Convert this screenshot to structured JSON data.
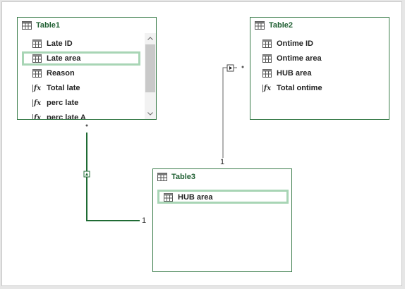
{
  "table1": {
    "title": "Table1",
    "fields": [
      {
        "label": "Late ID",
        "type": "column"
      },
      {
        "label": "Late area",
        "type": "column"
      },
      {
        "label": "Reason",
        "type": "column"
      },
      {
        "label": "Total late",
        "type": "measure"
      },
      {
        "label": "perc late",
        "type": "measure"
      },
      {
        "label": "perc late A",
        "type": "measure"
      }
    ]
  },
  "table2": {
    "title": "Table2",
    "fields": [
      {
        "label": "Ontime ID",
        "type": "column"
      },
      {
        "label": "Ontime area",
        "type": "column"
      },
      {
        "label": "HUB area",
        "type": "column"
      },
      {
        "label": "Total ontime",
        "type": "measure"
      }
    ]
  },
  "table3": {
    "title": "Table3",
    "fields": [
      {
        "label": "HUB area",
        "type": "column"
      }
    ]
  },
  "relationships": {
    "t1_t3_cardinality_one": "1",
    "t2_t3_cardinality_one": "1"
  },
  "colors": {
    "accent": "#3a7c4a",
    "selection": "#a8d5b5",
    "checkmark": "#e02020"
  }
}
